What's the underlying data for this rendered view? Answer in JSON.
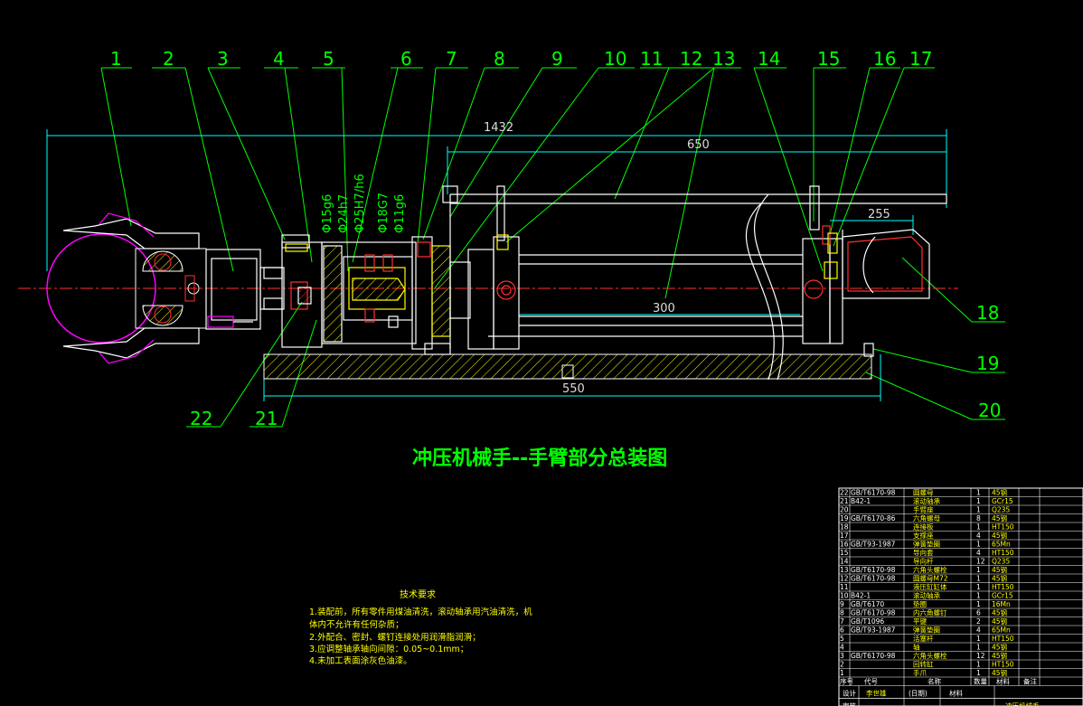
{
  "drawing": {
    "title": "冲压机械手--手臂部分总装图",
    "callouts": [
      "1",
      "2",
      "3",
      "4",
      "5",
      "6",
      "7",
      "8",
      "9",
      "10",
      "11",
      "12",
      "13",
      "14",
      "15",
      "16",
      "17",
      "18",
      "19",
      "20",
      "21",
      "22"
    ],
    "dimensions": {
      "overall": "1432",
      "upper": "650",
      "right": "255",
      "middle": "300",
      "base": "550"
    },
    "fits": [
      "Φ15g6",
      "Φ24h7",
      "Φ25H7/h6",
      "Φ18G7",
      "Φ11g6"
    ]
  },
  "tech_requirements": {
    "heading": "技术要求",
    "lines": [
      "1.装配前，所有零件用煤油清洗，滚动轴承用汽油清洗，机",
      "  体内不允许有任何杂质；",
      "2.外配合、密封、螺钉连接处用润滑脂润滑；",
      "3.应调整轴承轴向间隙：0.05~0.1mm；",
      "4.未加工表面涂灰色油漆。"
    ]
  },
  "bom": {
    "rows": [
      {
        "no": "22",
        "code": "GB/T6170-98",
        "name": "圆螺母",
        "qty": "1",
        "material": "45钢"
      },
      {
        "no": "21",
        "code": "B42-1",
        "name": "滚动轴承",
        "qty": "1",
        "material": "GCr15"
      },
      {
        "no": "20",
        "code": "",
        "name": "手臂座",
        "qty": "1",
        "material": "Q235"
      },
      {
        "no": "19",
        "code": "GB/T6170-86",
        "name": "六角螺母",
        "qty": "8",
        "material": "45钢"
      },
      {
        "no": "18",
        "code": "",
        "name": "连接板",
        "qty": "1",
        "material": "HT150"
      },
      {
        "no": "17",
        "code": "",
        "name": "支撑座",
        "qty": "4",
        "material": "45钢"
      },
      {
        "no": "16",
        "code": "GB/T93-1987",
        "name": "弹簧垫圈",
        "qty": "1",
        "material": "65Mn"
      },
      {
        "no": "15",
        "code": "",
        "name": "导向套",
        "qty": "4",
        "material": "HT150"
      },
      {
        "no": "14",
        "code": "",
        "name": "导向杆",
        "qty": "12",
        "material": "Q235"
      },
      {
        "no": "13",
        "code": "GB/T6170-98",
        "name": "六角头螺栓",
        "qty": "1",
        "material": "45钢"
      },
      {
        "no": "12",
        "code": "GB/T6170-98",
        "name": "圆螺母M72",
        "qty": "1",
        "material": "45钢"
      },
      {
        "no": "11",
        "code": "",
        "name": "液压缸缸体",
        "qty": "1",
        "material": "HT150"
      },
      {
        "no": "10",
        "code": "B42-1",
        "name": "滚动轴承",
        "qty": "1",
        "material": "GCr15"
      },
      {
        "no": "9",
        "code": "GB/T6170",
        "name": "垫圈",
        "qty": "1",
        "material": "16Mn"
      },
      {
        "no": "8",
        "code": "GB/T6170-98",
        "name": "内六角螺钉",
        "qty": "6",
        "material": "45钢"
      },
      {
        "no": "7",
        "code": "GB/T1096",
        "name": "平键",
        "qty": "2",
        "material": "45钢"
      },
      {
        "no": "6",
        "code": "GB/T93-1987",
        "name": "弹簧垫圈",
        "qty": "4",
        "material": "65Mn"
      },
      {
        "no": "5",
        "code": "",
        "name": "活塞杆",
        "qty": "1",
        "material": "HT150"
      },
      {
        "no": "4",
        "code": "",
        "name": "轴",
        "qty": "1",
        "material": "45钢"
      },
      {
        "no": "3",
        "code": "GB/T6170-98",
        "name": "六角头螺栓",
        "qty": "12",
        "material": "45钢"
      },
      {
        "no": "2",
        "code": "",
        "name": "回转缸",
        "qty": "1",
        "material": "HT150"
      },
      {
        "no": "1",
        "code": "",
        "name": "手爪",
        "qty": "1",
        "material": "45钢"
      }
    ],
    "header": {
      "no": "序号",
      "code": "代号",
      "name": "名称",
      "qty": "数量",
      "material": "材料",
      "note": "备注"
    },
    "footer": {
      "label1": "设计",
      "designer": "李世雄",
      "date": "(日期)",
      "material_label": "材料",
      "title_short": "冲压机械手",
      "label2": "审核"
    }
  }
}
